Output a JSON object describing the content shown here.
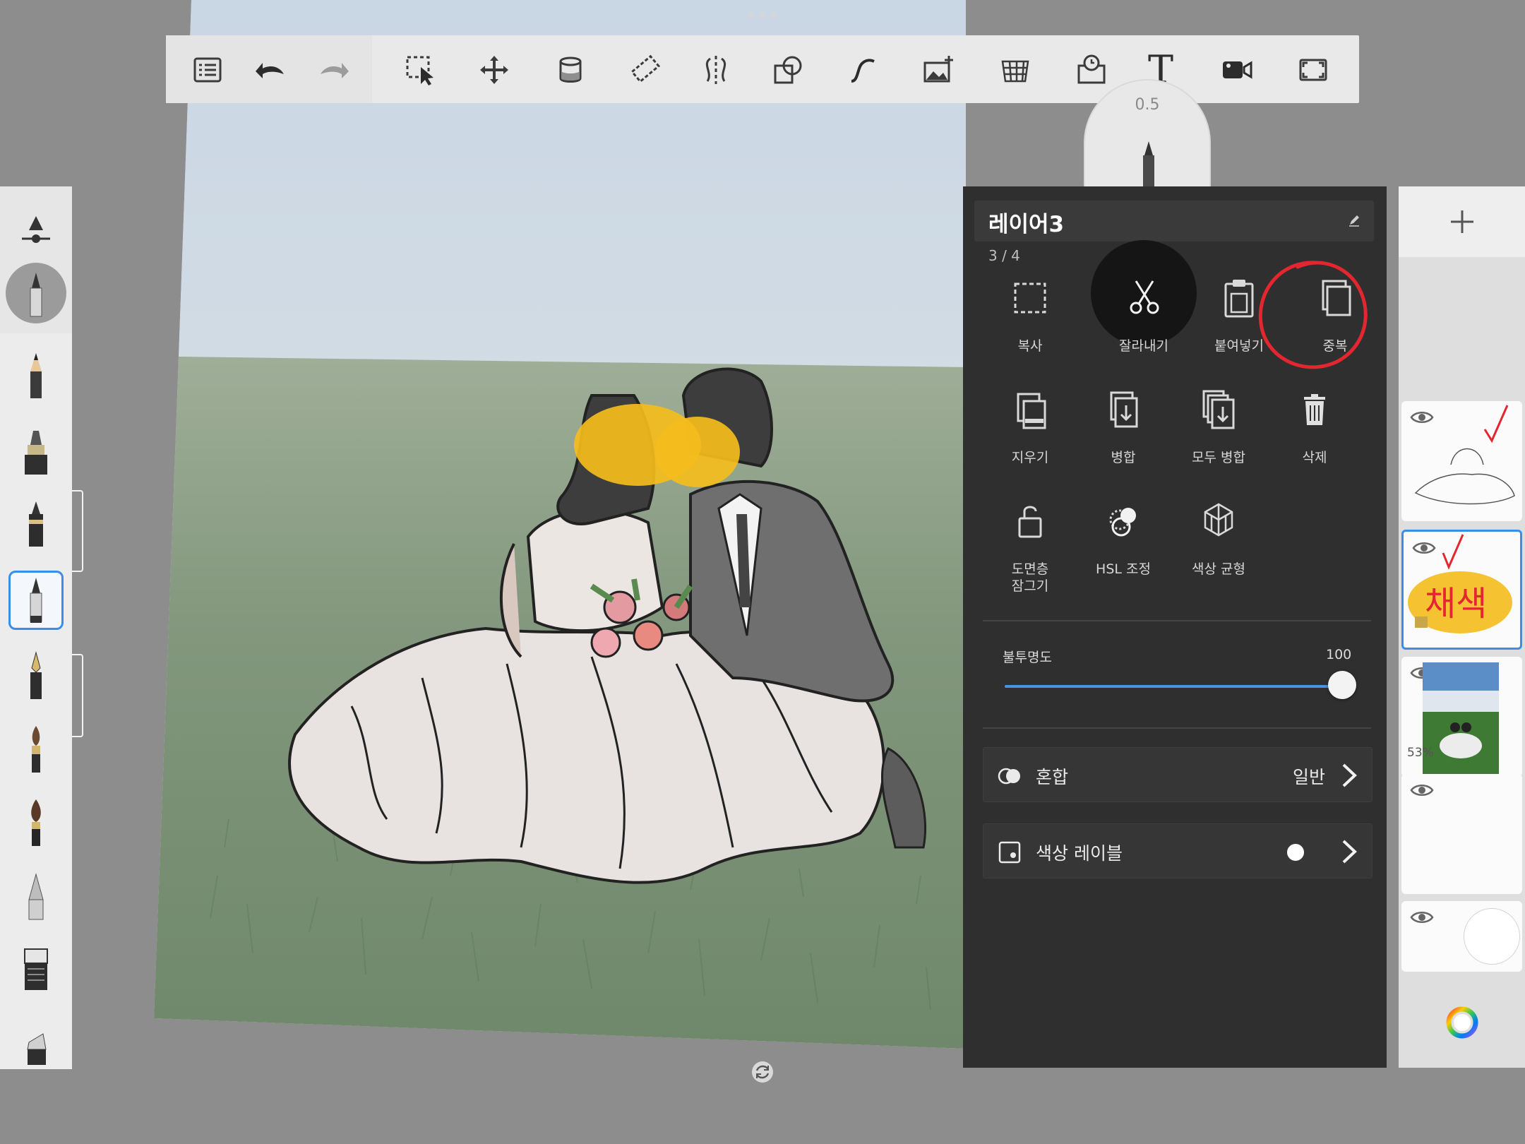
{
  "toolbar": {
    "buttons": [
      {
        "name": "layers-list",
        "icon": "list-icon"
      },
      {
        "name": "undo",
        "icon": "undo-icon"
      },
      {
        "name": "redo",
        "icon": "redo-icon"
      },
      {
        "name": "selection",
        "icon": "selection-icon"
      },
      {
        "name": "transform",
        "icon": "move-icon"
      },
      {
        "name": "fill",
        "icon": "paint-bucket-icon"
      },
      {
        "name": "ruler",
        "icon": "ruler-icon"
      },
      {
        "name": "symmetry",
        "icon": "symmetry-icon"
      },
      {
        "name": "shapes",
        "icon": "shapes-icon"
      },
      {
        "name": "curve",
        "icon": "curve-icon"
      },
      {
        "name": "import-image",
        "icon": "add-image-icon"
      },
      {
        "name": "perspective",
        "icon": "perspective-grid-icon"
      },
      {
        "name": "timelapse",
        "icon": "timelapse-icon"
      },
      {
        "name": "text",
        "icon": "text-icon"
      },
      {
        "name": "record",
        "icon": "video-icon"
      },
      {
        "name": "fullscreen",
        "icon": "fullscreen-icon"
      }
    ],
    "text_glyph": "T"
  },
  "puck": {
    "value": "0.5"
  },
  "layer_panel": {
    "title": "레이어3",
    "count": "3 / 4",
    "actions": {
      "copy": "복사",
      "cut": "잘라내기",
      "paste": "붙여넣기",
      "duplicate": "중복",
      "clear": "지우기",
      "merge": "병합",
      "merge_all": "모두 병합",
      "delete": "삭제",
      "lock_line1": "도면층",
      "lock_line2": "잠그기",
      "hsl": "HSL 조정",
      "color_balance": "색상 균형"
    },
    "opacity": {
      "label": "불투명도",
      "value": "100",
      "fraction": 1.0
    },
    "blend": {
      "label": "혼합",
      "value": "일반"
    },
    "color_label": {
      "label": "색상 레이블"
    }
  },
  "layers": {
    "thumbnails": [
      {
        "name": "layer-lineart",
        "visible": true
      },
      {
        "name": "layer-color",
        "visible": true,
        "selected": true,
        "note": "채색"
      },
      {
        "name": "layer-photo",
        "visible": true,
        "opacity_text": "53%"
      },
      {
        "name": "layer-empty",
        "visible": true
      },
      {
        "name": "layer-background",
        "visible": true
      }
    ]
  },
  "colors": {
    "accent": "#3b8ee8",
    "panel": "#2f2f2f",
    "annotation_red": "#e3262f",
    "highlight_yellow": "#f4bd1c"
  }
}
